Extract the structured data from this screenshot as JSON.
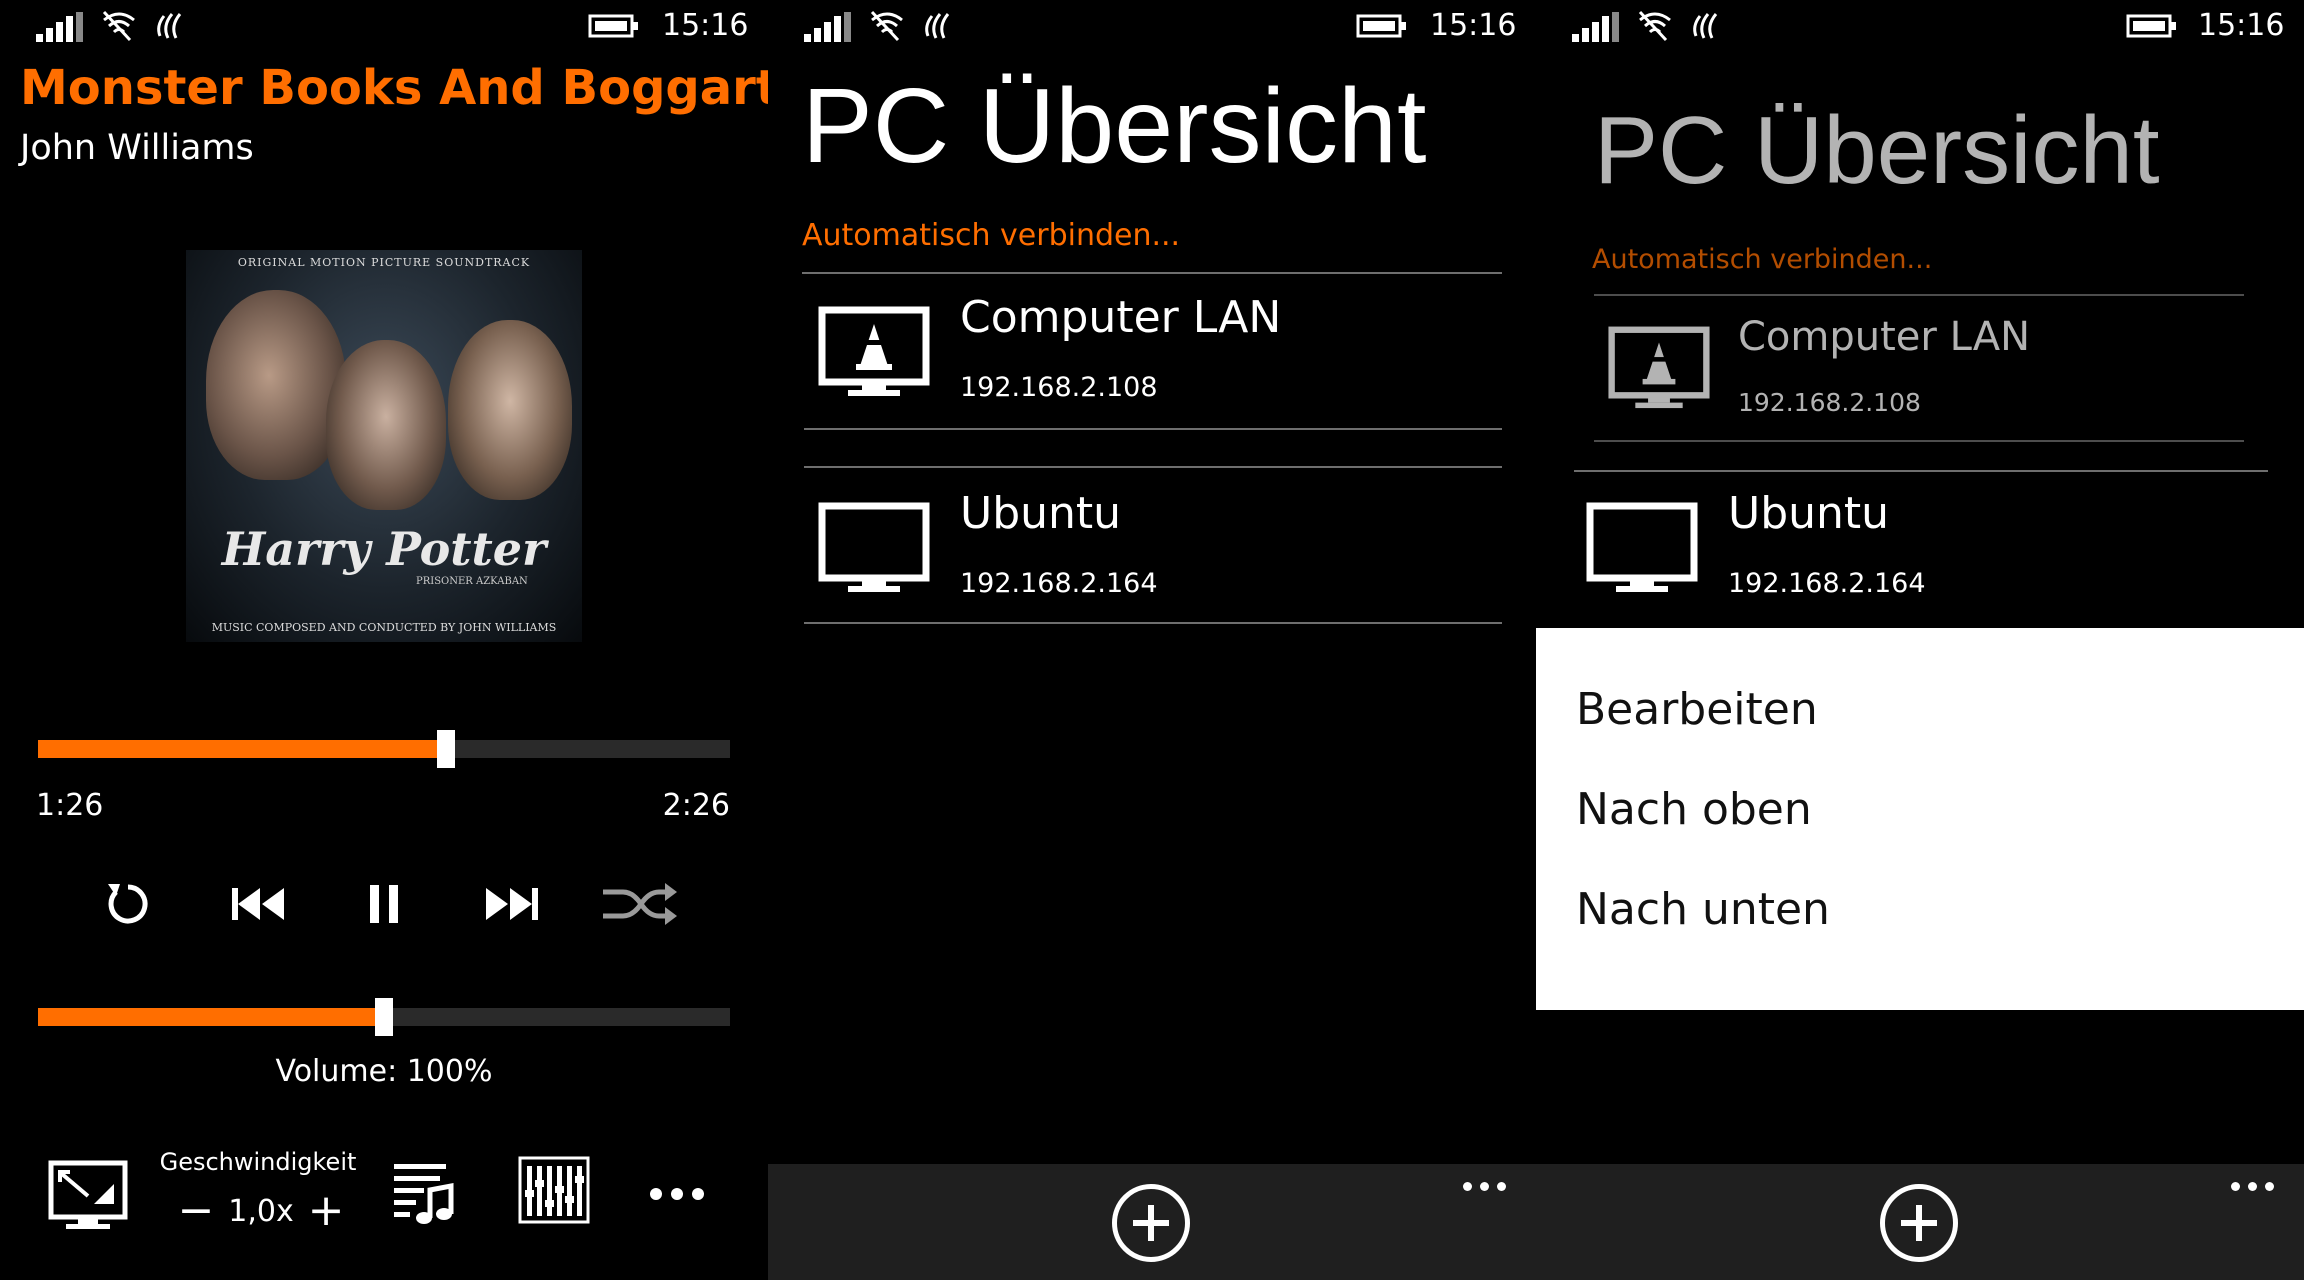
{
  "status": {
    "time": "15:16"
  },
  "player": {
    "song_title": "Monster Books And Boggarts!",
    "artist": "John Williams",
    "album_art": {
      "top_text": "ORIGINAL MOTION PICTURE SOUNDTRACK",
      "logo_text": "Harry Potter",
      "subtitle": "PRISONER AZKABAN",
      "bottom_text": "MUSIC COMPOSED AND CONDUCTED BY JOHN WILLIAMS"
    },
    "elapsed": "1:26",
    "duration": "2:26",
    "progress_fraction": 0.59,
    "volume_fraction": 0.5,
    "volume_label": "Volume: 100%",
    "speed_label": "Geschwindigkeit",
    "speed_minus": "−",
    "speed_value": "1,0x",
    "speed_plus": "+",
    "controls": [
      "repeat-icon",
      "previous-icon",
      "pause-icon",
      "next-icon",
      "shuffle-icon"
    ],
    "bottom_icons": [
      "cast-screen-icon",
      "playlist-icon",
      "equalizer-icon",
      "more-icon"
    ]
  },
  "pc_overview": {
    "title": "PC Übersicht",
    "auto_connect": "Automatisch verbinden...",
    "computers": [
      {
        "name": "Computer LAN",
        "ip": "192.168.2.108",
        "icon": "monitor-vlc-icon"
      },
      {
        "name": "Ubuntu",
        "ip": "192.168.2.164",
        "icon": "monitor-icon"
      }
    ]
  },
  "context_menu": {
    "items": [
      "Bearbeiten",
      "Nach oben",
      "Nach unten"
    ]
  },
  "colors": {
    "accent": "#ff6e00",
    "background": "#000000",
    "appbar": "#1f1f1f"
  }
}
